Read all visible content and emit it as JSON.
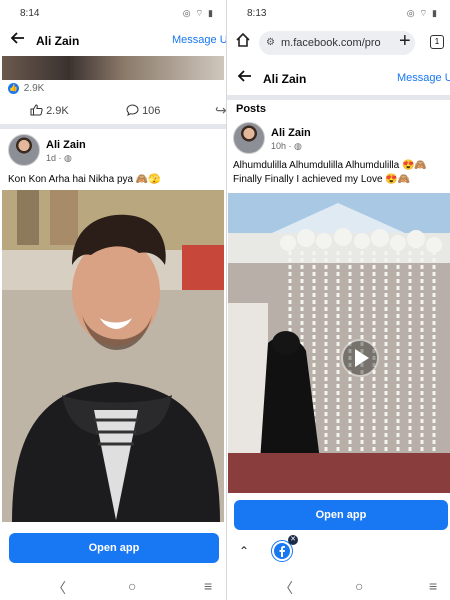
{
  "left": {
    "status_time": "8:14",
    "header": {
      "name": "Ali Zain",
      "message_label": "Message U"
    },
    "prev_post": {
      "reaction_count": "2.9K",
      "like_count": "2.9K",
      "comment_count": "106"
    },
    "post": {
      "author": "Ali Zain",
      "time": "1d",
      "caption": "Kon Kon Arha hai Nikha pya 🙈🫣"
    },
    "open_app_label": "Open app"
  },
  "right": {
    "status_time": "8:13",
    "browser": {
      "url": "m.facebook.com/pro",
      "tab_count": "1"
    },
    "header": {
      "name": "Ali Zain",
      "message_label": "Message U"
    },
    "section_title": "Posts",
    "post": {
      "author": "Ali Zain",
      "time": "10h",
      "caption_line1": "Alhumdulilla Alhumdulilla  Alhumdulilla 😍🙈",
      "caption_line2": "Finally Finally I achieved my Love 😍🙈"
    },
    "open_app_label": "Open app"
  },
  "colors": {
    "accent": "#1877f2",
    "divider": "#e4e6eb",
    "meta": "#65676b"
  },
  "icons": [
    "back-arrow-icon",
    "home-icon",
    "site-settings-icon",
    "plus-icon",
    "tabs-icon",
    "like-icon",
    "comment-icon",
    "share-icon",
    "globe-icon",
    "play-icon",
    "chevron-up-icon",
    "facebook-icon",
    "close-icon",
    "nav-back-icon",
    "nav-home-icon",
    "nav-recents-icon"
  ]
}
